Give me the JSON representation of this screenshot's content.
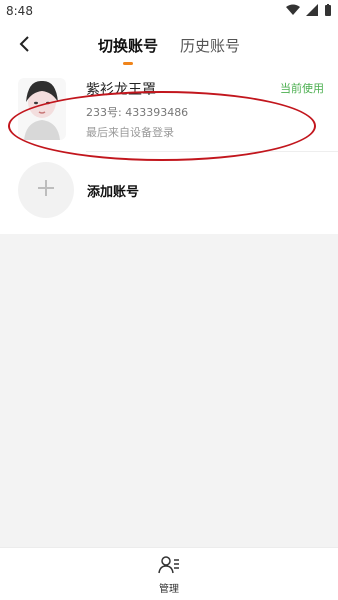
{
  "statusbar": {
    "time": "8:48"
  },
  "header": {
    "tab_switch": "切换账号",
    "tab_history": "历史账号"
  },
  "account": {
    "name": "紫衫龙王罩",
    "id_text": "233号: 433393486",
    "subtitle": "最后来自设备登录",
    "status": "当前使用"
  },
  "add_account": {
    "label": "添加账号"
  },
  "bottom": {
    "manage_label": "管理"
  },
  "colors": {
    "accent": "#f0841a",
    "status_green": "#4caf50",
    "annotation_red": "#c2161d"
  }
}
